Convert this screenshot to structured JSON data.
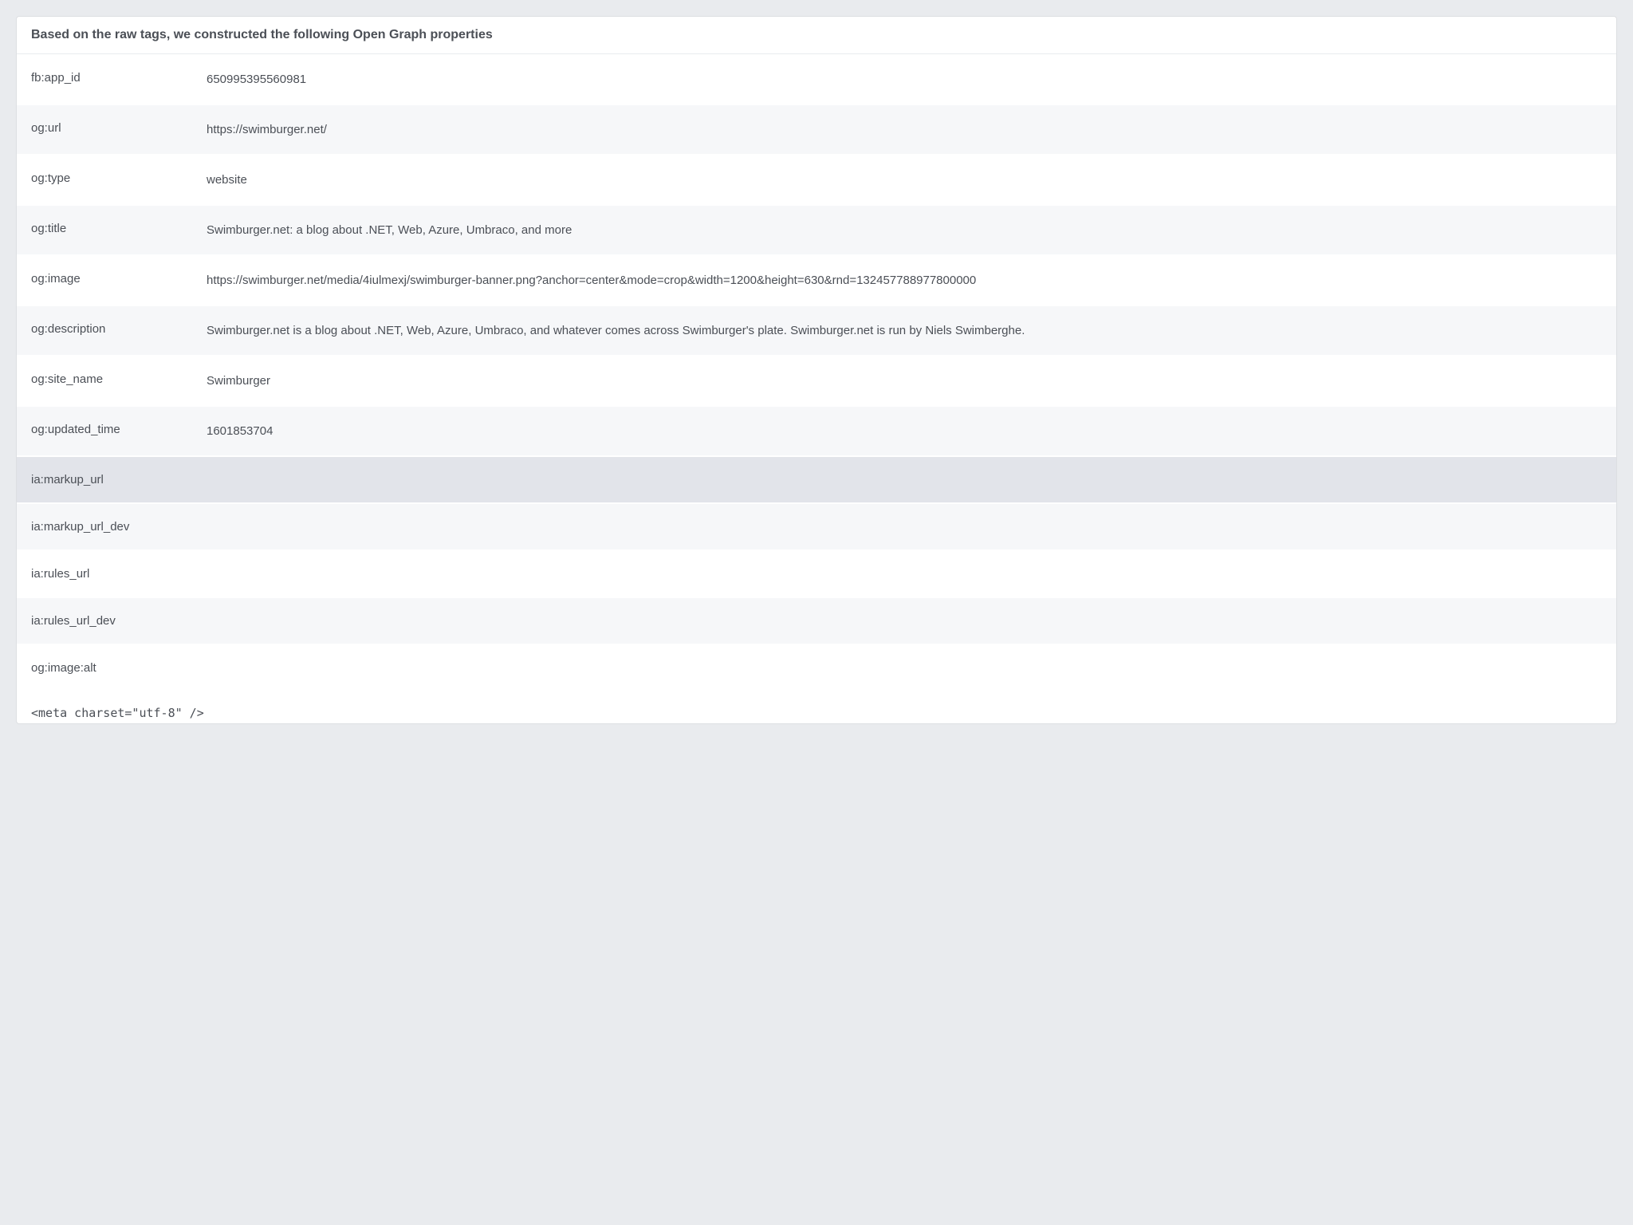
{
  "header": "Based on the raw tags, we constructed the following Open Graph properties",
  "rows": [
    {
      "key": "fb:app_id",
      "val": "650995395560981",
      "cls": ""
    },
    {
      "key": "og:url",
      "val": "https://swimburger.net/",
      "cls": "alt"
    },
    {
      "key": "og:type",
      "val": "website",
      "cls": ""
    },
    {
      "key": "og:title",
      "val": "Swimburger.net: a blog about .NET, Web, Azure, Umbraco, and more",
      "cls": "alt"
    },
    {
      "key": "og:image",
      "val": "https://swimburger.net/media/4iulmexj/swimburger-banner.png?anchor=center&mode=crop&width=1200&height=630&rnd=132457788977800000",
      "cls": ""
    },
    {
      "key": "og:description",
      "val": "Swimburger.net is a blog about .NET, Web, Azure, Umbraco, and whatever comes across Swimburger's plate. Swimburger.net is run by Niels Swimberghe.",
      "cls": "alt"
    },
    {
      "key": "og:site_name",
      "val": "Swimburger",
      "cls": ""
    },
    {
      "key": "og:updated_time",
      "val": "1601853704",
      "cls": "alt"
    },
    {
      "key": "ia:markup_url",
      "val": "",
      "cls": "hl"
    },
    {
      "key": "ia:markup_url_dev",
      "val": "",
      "cls": "alt"
    },
    {
      "key": "ia:rules_url",
      "val": "",
      "cls": ""
    },
    {
      "key": "ia:rules_url_dev",
      "val": "",
      "cls": "alt"
    },
    {
      "key": "og:image:alt",
      "val": "",
      "cls": ""
    }
  ],
  "meta_line": "<meta charset=\"utf-8\" />"
}
